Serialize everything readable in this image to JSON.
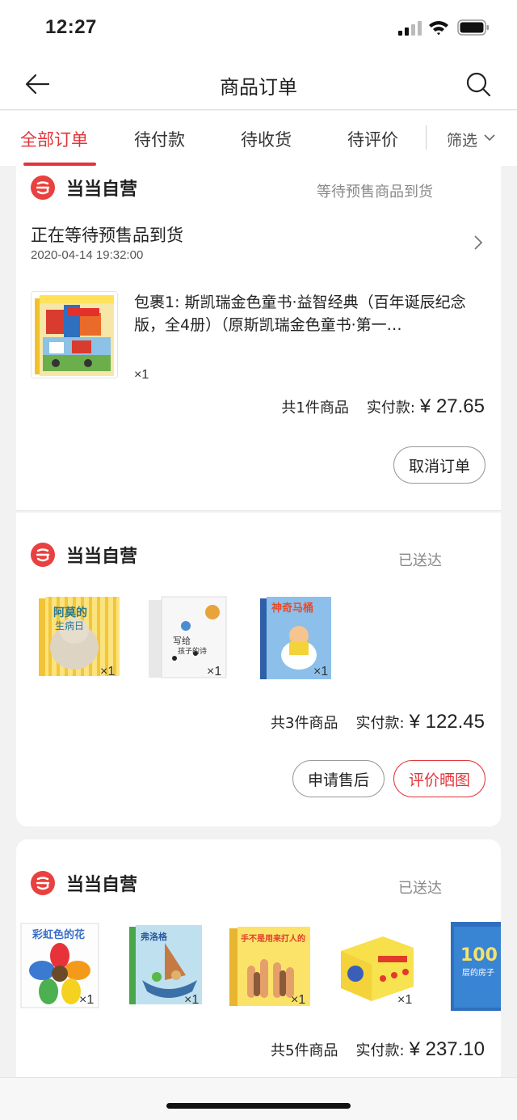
{
  "status_bar": {
    "time": "12:27"
  },
  "navbar": {
    "title": "商品订单"
  },
  "tabs": [
    {
      "label": "全部订单",
      "active": true
    },
    {
      "label": "待付款",
      "active": false
    },
    {
      "label": "待收货",
      "active": false
    },
    {
      "label": "待评价",
      "active": false
    }
  ],
  "filter_label": "筛选",
  "colors": {
    "accent": "#e2343a",
    "shop_logo": "#e8413f"
  },
  "orders": [
    {
      "shop_name": "当当自营",
      "status": "等待预售商品到货",
      "wait_title": "正在等待预售品到货",
      "wait_time": "2020-04-14 19:32:00",
      "product_name": "包裹1: 斯凯瑞金色童书·益智经典（百年诞辰纪念版，全4册）（原斯凯瑞金色童书·第一…",
      "item_qty": "×1",
      "count": "共1件商品",
      "paid_label": "实付款:",
      "amount": "¥ 27.65",
      "buttons": [
        "取消订单"
      ]
    },
    {
      "shop_name": "当当自营",
      "status": "已送达",
      "item_qtys": [
        "×1",
        "×1",
        "×1"
      ],
      "book_titles": [
        "阿莫的生病日",
        "写给孩子的诗",
        "神奇马桶"
      ],
      "count": "共3件商品",
      "paid_label": "实付款:",
      "amount": "¥ 122.45",
      "buttons": [
        "申请售后",
        "评价晒图"
      ]
    },
    {
      "shop_name": "当当自营",
      "status": "已送达",
      "item_qtys": [
        "×1",
        "×1",
        "×1",
        "×1"
      ],
      "book_titles": [
        "彩虹色的花",
        "弗洛格",
        "手不是用来打人的",
        "",
        "100层的房子"
      ],
      "count": "共5件商品",
      "paid_label": "实付款:",
      "amount": "¥ 237.10"
    }
  ]
}
